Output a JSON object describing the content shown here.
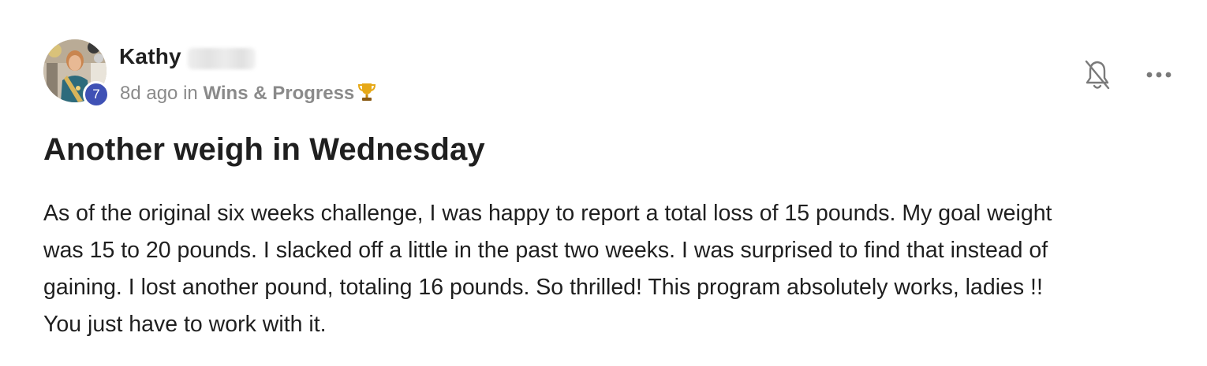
{
  "post": {
    "author": {
      "name": "Kathy",
      "level": "7",
      "avatar_icon": "profile-photo"
    },
    "meta": {
      "age": "8d ago",
      "in_word": "in",
      "category": "Wins & Progress",
      "category_icon": "trophy-icon"
    },
    "actions": {
      "bell_icon": "bell-off-icon",
      "more_icon": "more-horizontal-icon"
    },
    "title": "Another weigh in Wednesday",
    "body_lines": [
      "As of the original six weeks challenge, I was happy to report a total loss of 15 pounds. My goal weight",
      "was 15 to 20 pounds. I slacked off a little in the past two weeks. I was surprised to find that instead of",
      "gaining. I lost another pound, totaling 16 pounds. So thrilled! This program absolutely works, ladies !!",
      "You just have to work with it."
    ]
  },
  "colors": {
    "level_badge": "#3f51b5",
    "muted_text": "#8a8a8a",
    "primary_text": "#1f1f1f",
    "trophy": "#e6a817"
  }
}
